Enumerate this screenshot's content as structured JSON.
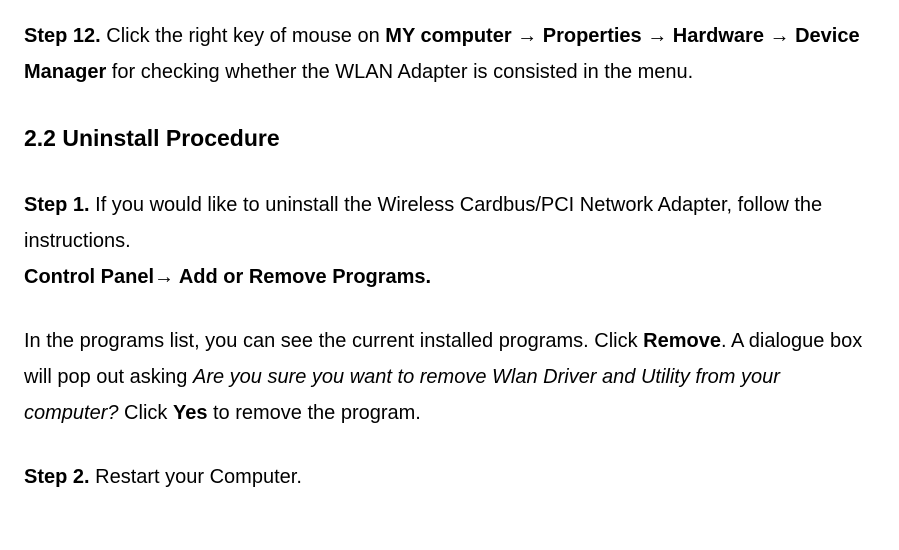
{
  "step12": {
    "label": "Step 12.",
    "before_path": " Click the right key of mouse on ",
    "path_1": "MY computer",
    "arrow": " → ",
    "path_2": "Properties",
    "path_3": "Hardware",
    "path_4": "Device Manager",
    "after_path": " for checking whether the WLAN Adapter is consisted in the menu."
  },
  "section_2_2": {
    "heading": "2.2 Uninstall Procedure"
  },
  "step1": {
    "label": "Step 1.",
    "text": " If you would like to uninstall the Wireless Cardbus/PCI Network Adapter, follow the instructions.",
    "cp_path_1": "Control Panel",
    "cp_arrow": "→",
    "cp_path_2": " Add or Remove Programs."
  },
  "para_remove": {
    "before_remove": "In the programs list, you can see the current installed programs. Click ",
    "remove": "Remove",
    "after_remove": ". A dialogue box will pop out asking ",
    "italic_prompt": "Are you sure you want to remove Wlan Driver and Utility from your computer?",
    "after_italic": " Click ",
    "yes": "Yes",
    "after_yes": " to remove the program."
  },
  "step2": {
    "label": "Step 2.",
    "text": " Restart your Computer."
  }
}
